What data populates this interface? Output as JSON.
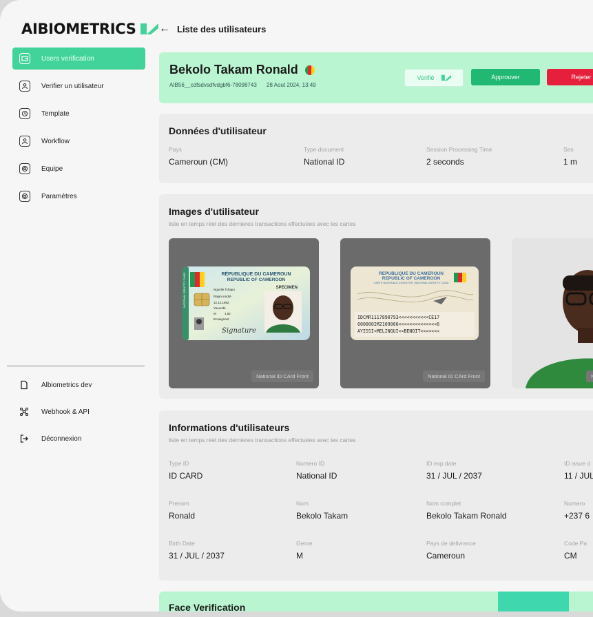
{
  "brand": {
    "name": "AIBIOMETRICS"
  },
  "sidebar": {
    "items": [
      {
        "label": "Users verification",
        "icon": "wallet-icon",
        "active": true
      },
      {
        "label": "Verifier un utilisateur",
        "icon": "user-icon"
      },
      {
        "label": "Template",
        "icon": "history-icon"
      },
      {
        "label": "Workflow",
        "icon": "user-icon"
      },
      {
        "label": "Equipe",
        "icon": "settings-icon"
      },
      {
        "label": "Paramètres",
        "icon": "settings-icon"
      }
    ],
    "bottom": [
      {
        "label": "Albiometrics dev",
        "icon": "document-icon"
      },
      {
        "label": "Webhook & API",
        "icon": "network-icon"
      },
      {
        "label": "Déconnexion",
        "icon": "logout-icon"
      }
    ]
  },
  "header": {
    "back_label": "Liste des utilisateurs"
  },
  "user": {
    "name": "Bekolo Takam Ronald",
    "id": "AIB56__cdfsdvsdfvdgbf6-78098743",
    "date": "28 Aout 2024, 13:49",
    "verified_label": "Verifié",
    "approve_label": "Approuver",
    "reject_label": "Rejeter"
  },
  "user_data": {
    "title": "Données  d'utilisateur",
    "fields": [
      {
        "label": "Pays",
        "value": "Cameroun (CM)"
      },
      {
        "label": "Type document",
        "value": "National ID"
      },
      {
        "label": "Session Processing Time",
        "value": "2 seconds"
      },
      {
        "label": "Ses",
        "value": "1 m"
      }
    ]
  },
  "images": {
    "title": "Images d'utilisateur",
    "subtitle": "liste en temps réel des dernieres transactions effectuées avec les cartes",
    "cards": [
      {
        "caption": "National ID CArd Front"
      },
      {
        "caption": "National ID CArd Front"
      },
      {
        "caption": "N"
      }
    ],
    "id_front": {
      "country_fr": "RÉPUBLIQUE DU CAMEROUN",
      "country_en": "REPUBLIC OF CAMEROON",
      "specimen": "SPECIMEN",
      "surname": "Ngonlie Tchapo",
      "given": "Rajani André",
      "dob": "12.12.1982",
      "pob": "Yaoundé",
      "sex": "M",
      "height": "1,82",
      "profession": "Enseignant",
      "signature": "Signature",
      "side_text": "NATIONAL IDENTITY CARD"
    },
    "id_back": {
      "country_fr": "REPUBLIQUE DU CAMEROUN",
      "country_en": "REPUBLIC OF CAMEROON",
      "subtitle": "CARTE NATIONALE D'IDENTITE | NATIONAL IDENTITY CARD",
      "mrz1": "IDCMR1117890793<<<<<<<<<<<CE17",
      "mrz2": "6000002M2109066<<<<<<<<<<<<<<6",
      "mrz3": "AYISSI<MELINGUI<<BENOIT<<<<<<<"
    }
  },
  "info": {
    "title": "Informations d'utilisateurs",
    "subtitle": "liste en temps réel des dernieres transactions effectuées avec les cartes",
    "rows": [
      [
        {
          "label": "Type ID",
          "value": "ID CARD"
        },
        {
          "label": "Numero ID",
          "value": "National ID"
        },
        {
          "label": "ID exp date",
          "value": "31 / JUL / 2037"
        },
        {
          "label": "ID issue d",
          "value": "11 / JUL"
        }
      ],
      [
        {
          "label": "Prenom",
          "value": "Ronald"
        },
        {
          "label": "Nom",
          "value": "Bekolo Takam"
        },
        {
          "label": "Nom complet",
          "value": "Bekolo Takam Ronald"
        },
        {
          "label": "Numero",
          "value": "+237 6"
        }
      ],
      [
        {
          "label": "Birth Date",
          "value": "31 / JUL / 2037"
        },
        {
          "label": "Genre",
          "value": "M"
        },
        {
          "label": "Pays de delivrance",
          "value": "Cameroun"
        },
        {
          "label": "Code Pa",
          "value": "CM"
        }
      ]
    ]
  },
  "face": {
    "title": "Face Verification"
  },
  "colors": {
    "accent": "#42d39a",
    "approve": "#21b873",
    "reject": "#e61f3c",
    "header_bg": "#b8f5d0"
  }
}
